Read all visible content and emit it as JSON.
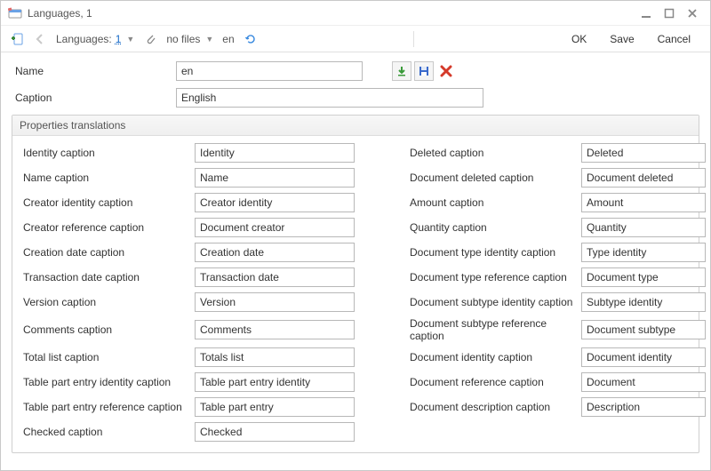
{
  "window": {
    "title": "Languages, 1"
  },
  "toolbar": {
    "breadcrumb_label": "Languages:",
    "breadcrumb_value": "1",
    "files_label": "no files",
    "lang_label": "en",
    "ok": "OK",
    "save": "Save",
    "cancel": "Cancel"
  },
  "form": {
    "name_label": "Name",
    "name_value": "en",
    "caption_label": "Caption",
    "caption_value": "English"
  },
  "group": {
    "legend": "Properties translations",
    "left": [
      {
        "label": "Identity caption",
        "value": "Identity"
      },
      {
        "label": "Name caption",
        "value": "Name"
      },
      {
        "label": "Creator identity caption",
        "value": "Creator identity"
      },
      {
        "label": "Creator reference caption",
        "value": "Document creator"
      },
      {
        "label": "Creation date caption",
        "value": "Creation date"
      },
      {
        "label": "Transaction date caption",
        "value": "Transaction date"
      },
      {
        "label": "Version caption",
        "value": "Version"
      },
      {
        "label": "Comments caption",
        "value": "Comments"
      },
      {
        "label": "Total list caption",
        "value": "Totals list"
      },
      {
        "label": "Table part entry identity caption",
        "value": "Table part entry identity"
      },
      {
        "label": "Table part entry reference caption",
        "value": "Table part entry"
      },
      {
        "label": "Checked caption",
        "value": "Checked"
      }
    ],
    "right": [
      {
        "label": "Deleted caption",
        "value": "Deleted"
      },
      {
        "label": "Document deleted caption",
        "value": "Document deleted"
      },
      {
        "label": "Amount caption",
        "value": "Amount"
      },
      {
        "label": "Quantity caption",
        "value": "Quantity"
      },
      {
        "label": "Document type identity caption",
        "value": "Type identity"
      },
      {
        "label": "Document type reference caption",
        "value": "Document type"
      },
      {
        "label": "Document subtype identity caption",
        "value": "Subtype identity"
      },
      {
        "label": "Document subtype reference caption",
        "value": "Document subtype"
      },
      {
        "label": "Document identity caption",
        "value": "Document identity"
      },
      {
        "label": "Document reference caption",
        "value": "Document"
      },
      {
        "label": "Document description caption",
        "value": "Description"
      }
    ]
  }
}
